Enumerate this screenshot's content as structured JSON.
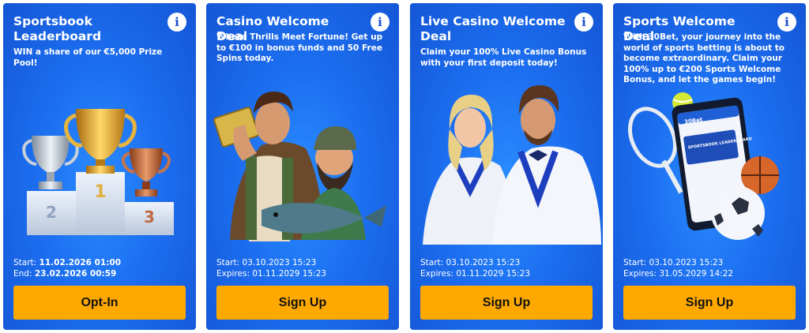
{
  "cards": [
    {
      "title": "Sportsbook Leaderboard",
      "description": "WIN a share of our €5,000 Prize Pool!",
      "start_label": "Start:",
      "start_value": "11.02.2026 01:00",
      "end_label": "End:",
      "end_value": "23.02.2026 00:59",
      "button": "Opt-In",
      "podium_numbers": [
        "2",
        "1",
        "3"
      ]
    },
    {
      "title": "Casino Welcome Deal",
      "description": "Where Thrills Meet Fortune! Get up to €100 in bonus funds and 50 Free Spins today.",
      "start_label": "Start:",
      "start_value": "03.10.2023 15:23",
      "end_label": "Expires:",
      "end_value": "01.11.2029 15:23",
      "button": "Sign Up"
    },
    {
      "title": "Live Casino Welcome Deal",
      "description": "Claim your 100% Live Casino Bonus with your first deposit today!",
      "start_label": "Start:",
      "start_value": "03.10.2023 15:23",
      "end_label": "Expires:",
      "end_value": "01.11.2029 15:23",
      "button": "Sign Up"
    },
    {
      "title": "Sports Welcome Deal",
      "description": "With 30Bet, your journey into the world of sports betting is about to become extraordinary. Claim your 100% up to €200 Sports Welcome Bonus, and let the games begin!",
      "start_label": "Start:",
      "start_value": "03.10.2023 15:23",
      "end_label": "Expires:",
      "end_value": "31.05.2029 14:22",
      "button": "Sign Up",
      "phone_brand": "30Bet",
      "phone_text": "SPORTSBOOK LEADERBOARD"
    }
  ],
  "info_glyph": "i",
  "colors": {
    "card_bg": "#1c6ff0",
    "button": "#ffa900",
    "info_circle": "#ffffff"
  }
}
